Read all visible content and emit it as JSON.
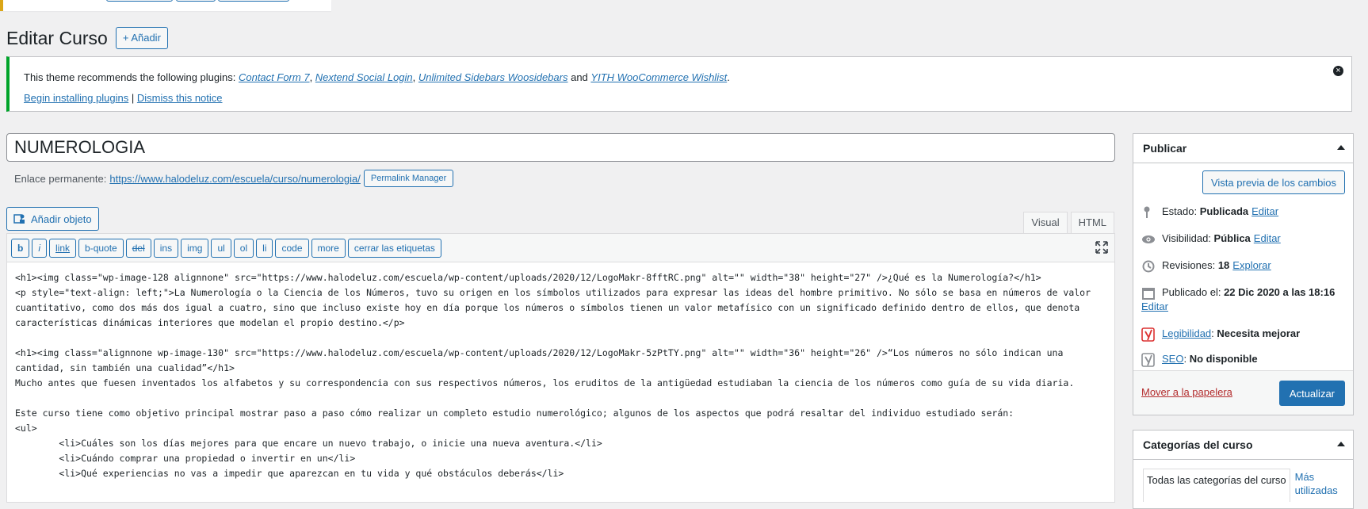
{
  "page": {
    "title": "Editar Curso",
    "add_button": "+ Añadir"
  },
  "notice": {
    "text_before": "This theme recommends the following plugins: ",
    "plugins": [
      "Contact Form 7",
      "Nextend Social Login",
      "Unlimited Sidebars Woosidebars",
      "YITH WooCommerce Wishlist"
    ],
    "sep": ", ",
    "and": " and ",
    "end": ".",
    "install_link": "Begin installing plugins",
    "pipe": " | ",
    "dismiss_link": "Dismiss this notice"
  },
  "post": {
    "title": "NUMEROLOGIA",
    "permalink_label": "Enlace permanente:",
    "permalink_url": "https://www.halodeluz.com/escuela/curso/numerologia/",
    "permalink_button": "Permalink Manager"
  },
  "editor": {
    "add_media": "Añadir objeto",
    "tabs": [
      "Visual",
      "HTML"
    ],
    "quicktags": [
      "b",
      "i",
      "link",
      "b-quote",
      "del",
      "ins",
      "img",
      "ul",
      "ol",
      "li",
      "code",
      "more",
      "cerrar las etiquetas"
    ],
    "content": "<h1><img class=\"wp-image-128 alignnone\" src=\"https://www.halodeluz.com/escuela/wp-content/uploads/2020/12/LogoMakr-8fftRC.png\" alt=\"\" width=\"38\" height=\"27\" />¿Qué es la Numerología?</h1>\n<p style=\"text-align: left;\">La Numerología o la Ciencia de los Números, tuvo su origen en los símbolos utilizados para expresar las ideas del hombre primitivo. No sólo se basa en números de valor cuantitativo, como dos más dos igual a cuatro, sino que incluso existe hoy en día porque los números o símbolos tienen un valor metafísico con un significado definido dentro de ellos, que denota características dinámicas interiores que modelan el propio destino.</p>\n\n<h1><img class=\"alignnone wp-image-130\" src=\"https://www.halodeluz.com/escuela/wp-content/uploads/2020/12/LogoMakr-5zPtTY.png\" alt=\"\" width=\"36\" height=\"26\" />“Los números no sólo indican una cantidad, sin también una cualidad”</h1>\nMucho antes que fuesen inventados los alfabetos y su correspondencia con sus respectivos números, los eruditos de la antigüedad estudiaban la ciencia de los números como guía de su vida diaria.\n\nEste curso tiene como objetivo principal mostrar paso a paso cómo realizar un completo estudio numerológico; algunos de los aspectos que podrá resaltar del individuo estudiado serán:\n<ul>\n        <li>Cuáles son los días mejores para que encare un nuevo trabajo, o inicie una nueva aventura.</li>\n        <li>Cuándo comprar una propiedad o invertir en un</li>\n        <li>Qué experiencias no vas a impedir que aparezcan en tu vida y qué obstáculos deberás</li>"
  },
  "publish": {
    "title": "Publicar",
    "preview_button": "Vista previa de los cambios",
    "status_label": "Estado:",
    "status_value": "Publicada",
    "visibility_label": "Visibilidad:",
    "visibility_value": "Pública",
    "revisions_label": "Revisiones:",
    "revisions_value": "18",
    "explore": "Explorar",
    "published_label": "Publicado el:",
    "published_value": "22 Dic 2020 a las 18:16",
    "edit": "Editar",
    "readability_label": "Legibilidad",
    "readability_value": "Necesita mejorar",
    "seo_label": "SEO",
    "seo_value": "No disponible",
    "trash": "Mover a la papelera",
    "update_button": "Actualizar"
  },
  "categories": {
    "title": "Categorías del curso",
    "tab_all": "Todas las categorías del curso",
    "tab_most": "Más utilizadas"
  },
  "colors": {
    "accent": "#2271b1",
    "success": "#00a32a",
    "warning": "#dba617",
    "danger": "#b32d2e"
  }
}
